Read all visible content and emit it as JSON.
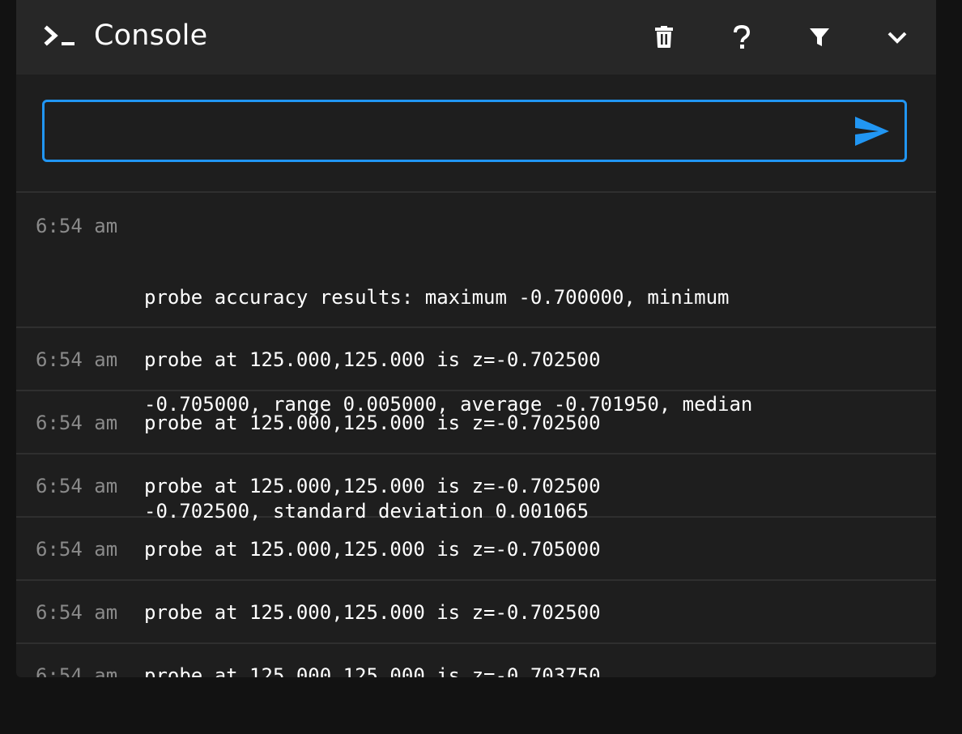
{
  "header": {
    "title": "Console",
    "icons": {
      "title": "terminal-icon",
      "clear": "trash-icon",
      "help": "help-icon",
      "filter": "filter-icon",
      "collapse": "chevron-down-icon"
    }
  },
  "command_input": {
    "value": "",
    "placeholder": "",
    "send_icon": "send-icon"
  },
  "colors": {
    "accent": "#2196f3",
    "background": "#1e1e1e",
    "toolbar": "#272727",
    "timestamp": "#8a8a8a",
    "text": "#ffffff"
  },
  "entries": [
    {
      "time": "6:54 am",
      "lines": [
        "probe accuracy results: maximum -0.700000, minimum",
        "-0.705000, range 0.005000, average -0.701950, median",
        "-0.702500, standard deviation 0.001065"
      ]
    },
    {
      "time": "6:54 am",
      "lines": [
        "probe at 125.000,125.000 is z=-0.702500"
      ]
    },
    {
      "time": "6:54 am",
      "lines": [
        "probe at 125.000,125.000 is z=-0.702500"
      ]
    },
    {
      "time": "6:54 am",
      "lines": [
        "probe at 125.000,125.000 is z=-0.702500"
      ]
    },
    {
      "time": "6:54 am",
      "lines": [
        "probe at 125.000,125.000 is z=-0.705000"
      ]
    },
    {
      "time": "6:54 am",
      "lines": [
        "probe at 125.000,125.000 is z=-0.702500"
      ]
    },
    {
      "time": "6:54 am",
      "lines": [
        "probe at 125.000,125.000 is z=-0.703750"
      ]
    }
  ]
}
